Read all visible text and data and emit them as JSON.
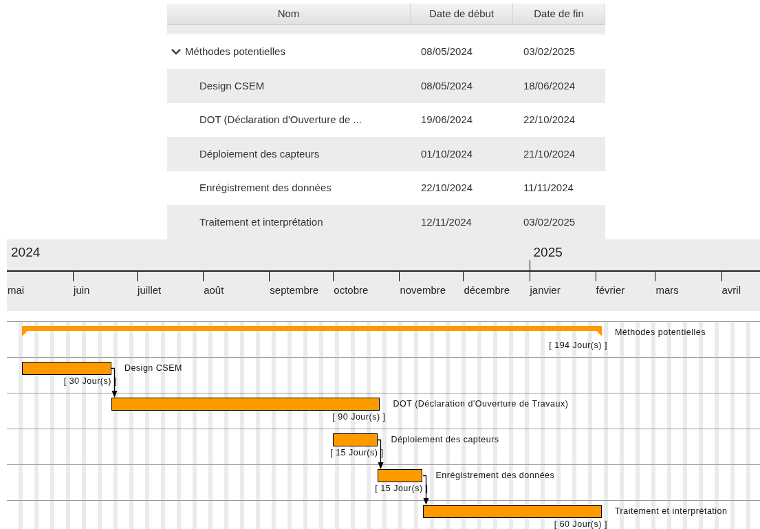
{
  "table": {
    "columns": [
      "Nom",
      "Date de début",
      "Date de fin"
    ],
    "rows": [
      {
        "name": "Méthodes potentielles",
        "start": "08/05/2024",
        "end": "03/02/2025",
        "expanded": true,
        "children": [
          {
            "name": "Design CSEM",
            "start": "08/05/2024",
            "end": "18/06/2024"
          },
          {
            "name": "DOT (Déclaration d'Ouverture de ...",
            "start": "19/06/2024",
            "end": "22/10/2024"
          },
          {
            "name": "Déploiement des capteurs",
            "start": "01/10/2024",
            "end": "21/10/2024"
          },
          {
            "name": "Enrégistrement des données",
            "start": "22/10/2024",
            "end": "11/11/2024"
          },
          {
            "name": "Traitement et interprétation",
            "start": "12/11/2024",
            "end": "03/02/2025"
          }
        ]
      }
    ]
  },
  "gantt": {
    "years": [
      "2024",
      "2025"
    ],
    "months": [
      "mai",
      "juin",
      "juillet",
      "août",
      "septembre",
      "octobre",
      "novembre",
      "décembre",
      "janvier",
      "février",
      "mars",
      "avril"
    ],
    "tasks": [
      {
        "kind": "summary",
        "label": "Méthodes potentielles",
        "duration": "[ 194 Jour(s) ]",
        "depends_on_previous": false
      },
      {
        "kind": "task",
        "label": "Design CSEM",
        "duration": "[ 30 Jour(s) ]",
        "depends_on_previous": false
      },
      {
        "kind": "task",
        "label": "DOT (Déclaration d'Ouverture de Travaux)",
        "duration": "[ 90 Jour(s) ]",
        "depends_on_previous": true
      },
      {
        "kind": "task",
        "label": "Déploiement des capteurs",
        "duration": "[ 15 Jour(s) ]",
        "depends_on_previous": false
      },
      {
        "kind": "task",
        "label": "Enrégistrement des données",
        "duration": "[ 15 Jour(s) ]",
        "depends_on_previous": true
      },
      {
        "kind": "task",
        "label": "Traitement et interprétation",
        "duration": "[ 60 Jour(s) ]",
        "depends_on_previous": true
      }
    ]
  }
}
